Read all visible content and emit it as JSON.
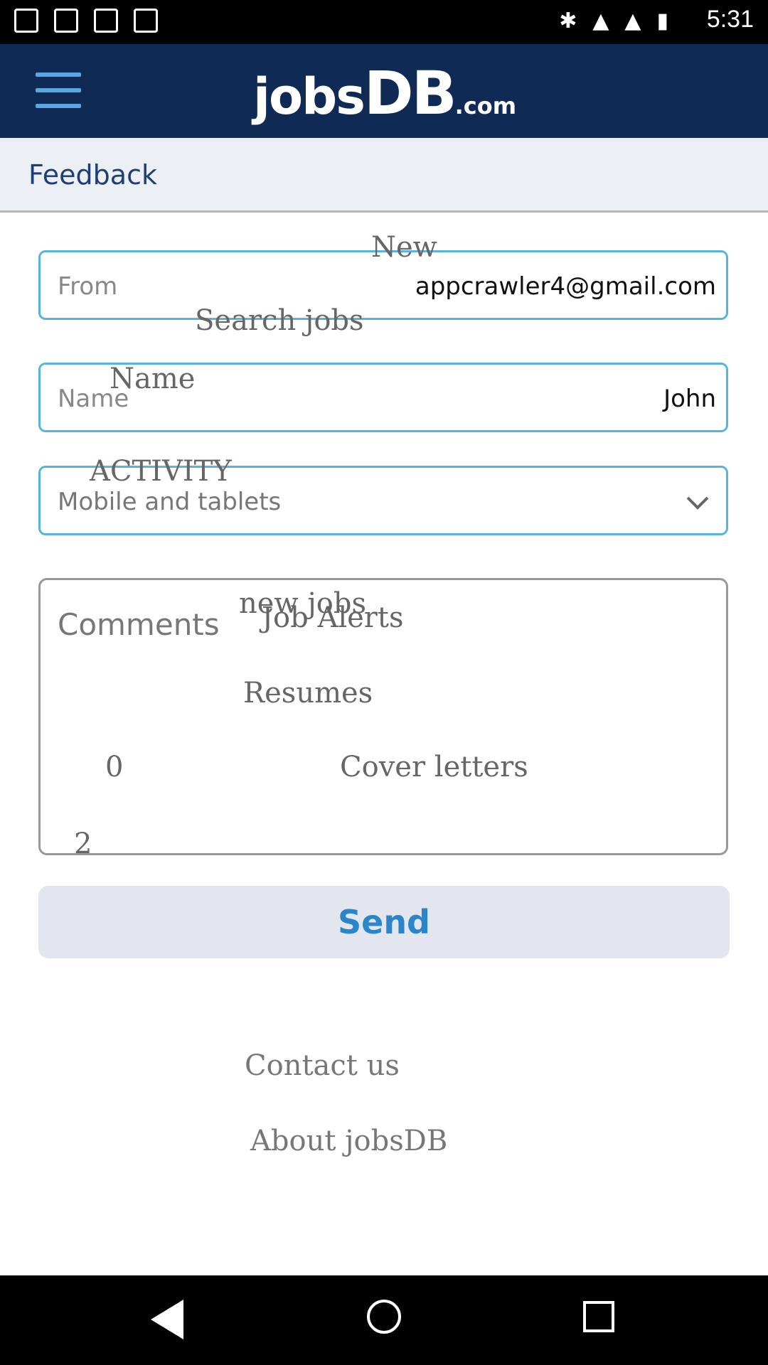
{
  "status_bar": {
    "time": "5:31"
  },
  "header": {
    "logo_text_jobs": "jobs",
    "logo_text_db": "DB",
    "logo_text_com": ".com"
  },
  "section": {
    "title": "Feedback"
  },
  "form": {
    "from": {
      "label": "From",
      "value": "appcrawler4@gmail.com"
    },
    "name": {
      "label": "Name",
      "value": "John"
    },
    "category": {
      "value": "Mobile and tablets"
    },
    "comments": {
      "label": "Comments"
    },
    "send_label": "Send"
  },
  "ghost_overlay": {
    "new": "New",
    "search_jobs": "Search jobs",
    "name": "Name",
    "activity": "ACTIVITY",
    "new_jobs": "new jobs",
    "job_alerts": "Job Alerts",
    "resumes": "Resumes",
    "zero": "0",
    "cover_letters": "Cover letters",
    "two": "2"
  },
  "footer": {
    "contact": "Contact us",
    "about": "About jobsDB"
  },
  "colors": {
    "appbar": "#0f2a55",
    "accent": "#2a86c9",
    "field_border": "#5ab3dd"
  },
  "icons": [
    "menu-icon",
    "chevron-down-icon",
    "back-icon",
    "home-icon",
    "recents-icon"
  ]
}
